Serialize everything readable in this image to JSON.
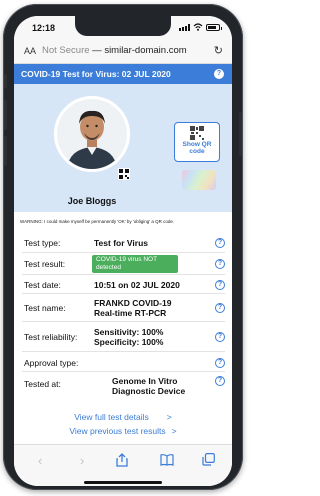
{
  "statusbar": {
    "time": "12:18",
    "location_arrow": "◂",
    "wifi": "wifi-icon",
    "battery_level": 0.8
  },
  "addressbar": {
    "aa": "AA",
    "security": "Not Secure",
    "separator": " — ",
    "url": "similar-domain.com",
    "reload_icon": "reload-icon"
  },
  "banner": {
    "title": "COVID-19 Test for Virus: 02 JUL 2020",
    "help": "?"
  },
  "profile": {
    "name": "Joe Bloggs",
    "qr_button_label_1": "Show QR",
    "qr_button_label_2": "code"
  },
  "warning": {
    "text": "WARNING: I could make myself be permanently 'OK' by 'obliging' a QR code."
  },
  "details": {
    "rows": [
      {
        "label": "Test type:",
        "value": "Test for Virus",
        "help": "?"
      },
      {
        "label": "Test result:",
        "badge": "COVID-19 virus NOT detected",
        "help": "?"
      },
      {
        "label": "Test date:",
        "value": "10:51 on 02 JUL 2020",
        "help": "?"
      },
      {
        "label": "Test name:",
        "value": "FRANKD COVID-19",
        "value2": "Real-time RT-PCR",
        "help": "?"
      },
      {
        "label": "Test reliability:",
        "value": "Sensitivity: 100%",
        "value2": "Specificity: 100%",
        "help": "?"
      },
      {
        "label": "Approval type:",
        "value": "",
        "help": "?"
      },
      {
        "label": "Tested at:",
        "value": "Genome In Vitro",
        "value2": "Diagnostic Device",
        "help": "?"
      }
    ]
  },
  "links": {
    "full_details": "View full test details",
    "previous": "View previous test results",
    "chevron": ">"
  },
  "toolbar": {
    "back": "‹",
    "forward": "›",
    "share": "⇪",
    "bookmarks": "⧉",
    "tabs": "⧉"
  },
  "colors": {
    "accent": "#3b7dd8",
    "success": "#4bae5c",
    "profile_bg": "#d7e6f7"
  }
}
